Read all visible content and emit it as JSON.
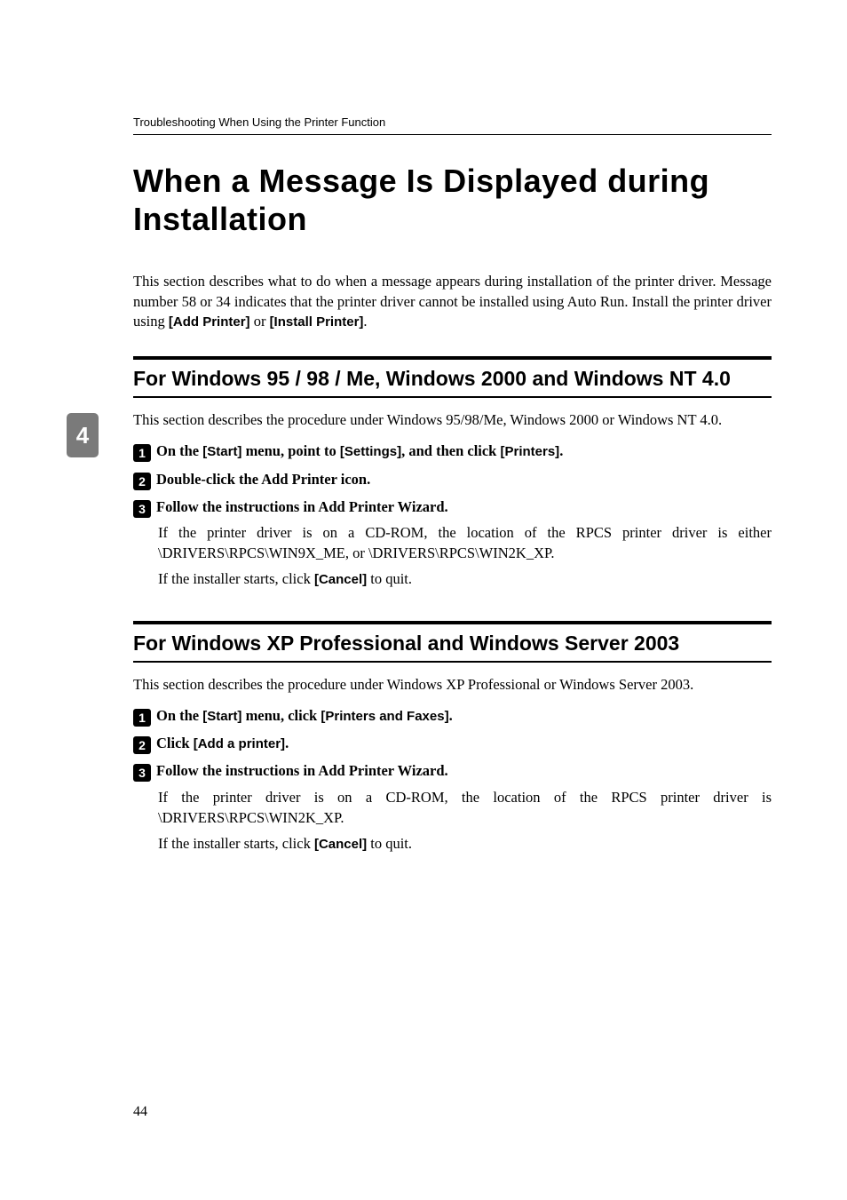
{
  "header": {
    "breadcrumb": "Troubleshooting When Using the Printer Function"
  },
  "title": "When a Message Is Displayed during Installation",
  "intro": {
    "text_before": "This section describes what to do when a message appears during installation of the printer driver. Message number 58 or 34 indicates that the printer driver cannot be installed using Auto Run. Install the printer driver using ",
    "label_add": "[Add Printer]",
    "text_mid": " or ",
    "label_install": "[Install Printer]",
    "text_after": "."
  },
  "chapter_tab": "4",
  "section1": {
    "heading": "For Windows 95 / 98 / Me, Windows 2000 and Windows NT 4.0",
    "intro": "This section describes the procedure under Windows 95/98/Me, Windows 2000 or Windows NT 4.0.",
    "step1": {
      "num": "1",
      "t1": "On the ",
      "l1": "[Start]",
      "t2": " menu, point to ",
      "l2": "[Settings]",
      "t3": ", and then click ",
      "l3": "[Printers]",
      "t4": "."
    },
    "step2": {
      "num": "2",
      "text": "Double-click the Add Printer icon."
    },
    "step3": {
      "num": "3",
      "text": "Follow the instructions in Add Printer Wizard.",
      "body1": "If the printer driver is on a CD-ROM, the location of the RPCS printer driver is either \\DRIVERS\\RPCS\\WIN9X_ME, or \\DRIVERS\\RPCS\\WIN2K_XP.",
      "body2_before": "If the installer starts, click ",
      "body2_label": "[Cancel]",
      "body2_after": " to quit."
    }
  },
  "section2": {
    "heading": "For Windows XP Professional and Windows Server 2003",
    "intro": "This section describes the procedure under Windows XP Professional or Windows Server 2003.",
    "step1": {
      "num": "1",
      "t1": "On the ",
      "l1": "[Start]",
      "t2": " menu, click ",
      "l2": "[Printers and Faxes]",
      "t3": "."
    },
    "step2": {
      "num": "2",
      "t1": "Click ",
      "l1": "[Add a printer]",
      "t2": "."
    },
    "step3": {
      "num": "3",
      "text": "Follow the instructions in Add Printer Wizard.",
      "body1": "If the printer driver is on a CD-ROM, the location of the RPCS printer driver is \\DRIVERS\\RPCS\\WIN2K_XP.",
      "body2_before": "If the installer starts, click ",
      "body2_label": "[Cancel]",
      "body2_after": " to quit."
    }
  },
  "page_number": "44"
}
